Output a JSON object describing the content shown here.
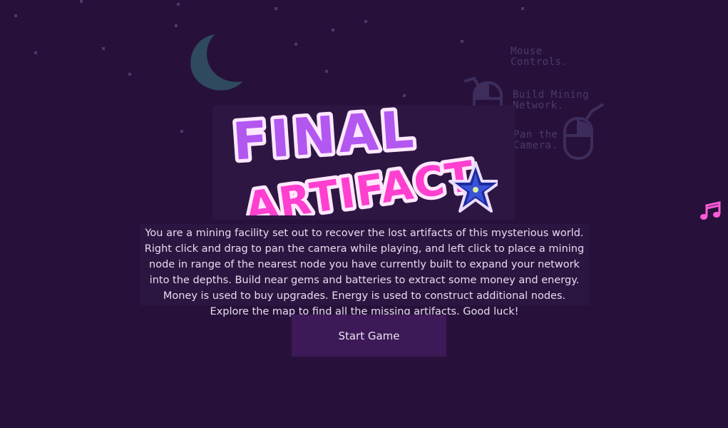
{
  "logo": {
    "line1": "FINAL",
    "line2": "ARTIFACT"
  },
  "controls": {
    "title": "Mouse\nControls.",
    "left_click_label": "Build Mining\nNetwork.",
    "right_click_label": "Pan the\nCamera."
  },
  "intro": {
    "description": "You are a mining facility set out to recover the lost artifacts of this mysterious world.  Right click and drag to pan the camera while playing, and left click to place a mining node in range of the nearest node you have currently built to expand your network into the depths.  Build near gems and batteries to extract some money and energy.  Money is used to buy upgrades.  Energy is used to construct additional nodes.  Explore the map to find all the missing artifacts.  Good luck!"
  },
  "buttons": {
    "start_label": "Start Game"
  },
  "icons": {
    "music": "music-note-icon",
    "moon": "crescent-moon-icon",
    "mouse": "mouse-icon",
    "star": "star-icon"
  },
  "colors": {
    "background": "#27113a",
    "logo_purple": "#b257f0",
    "logo_pink": "#ff3fd0",
    "star_blue": "#1c2a9c",
    "ui_dim": "#4b3a6c",
    "button_bg": "#3d1957"
  }
}
